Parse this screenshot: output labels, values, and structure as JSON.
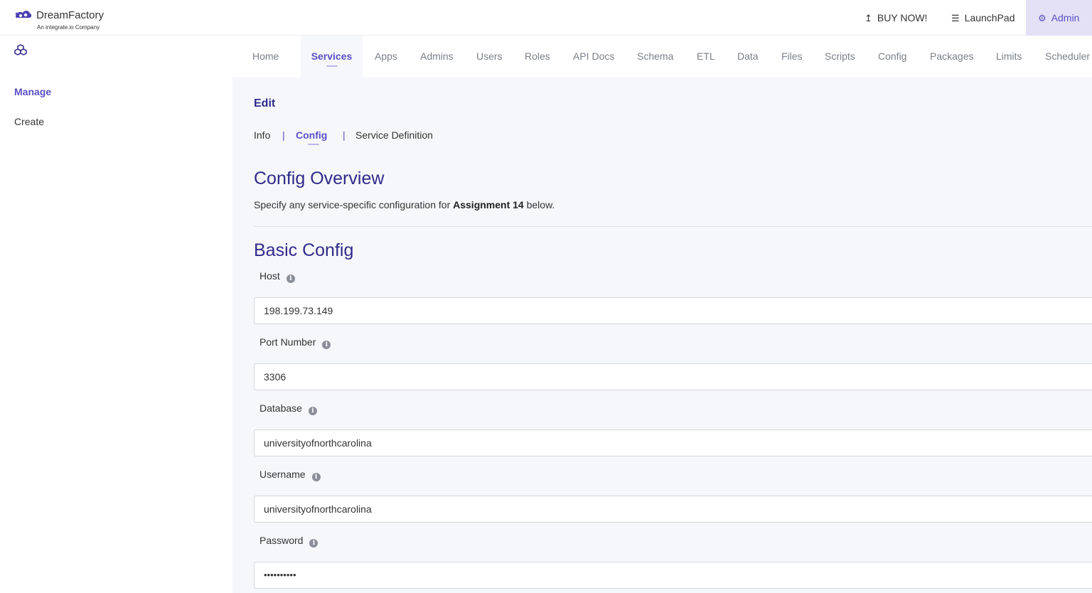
{
  "brand": {
    "name": "DreamFactory",
    "tagline": "An integrate.io Company",
    "colors": {
      "accent": "#5a4fc4",
      "heading": "#2f2a8a",
      "admin_bg": "#e4e1f6",
      "content_bg": "#f6f7fa"
    }
  },
  "header": {
    "buy_now": {
      "label": "BUY NOW!",
      "icon": "upload-arrow-icon"
    },
    "launchpad": {
      "label": "LaunchPad",
      "icon": "hamburger-menu-icon"
    },
    "admin": {
      "label": "Admin",
      "icon": "gear-icon"
    }
  },
  "sidebar": {
    "icon": "services-cubes-icon",
    "items": [
      {
        "label": "Manage",
        "active": true
      },
      {
        "label": "Create",
        "active": false
      }
    ]
  },
  "nav": {
    "tabs": [
      {
        "label": "Home"
      },
      {
        "label": "Services",
        "active": true
      },
      {
        "label": "Apps"
      },
      {
        "label": "Admins"
      },
      {
        "label": "Users"
      },
      {
        "label": "Roles"
      },
      {
        "label": "API Docs"
      },
      {
        "label": "Schema"
      },
      {
        "label": "ETL"
      },
      {
        "label": "Data"
      },
      {
        "label": "Files"
      },
      {
        "label": "Scripts"
      },
      {
        "label": "Config"
      },
      {
        "label": "Packages"
      },
      {
        "label": "Limits"
      },
      {
        "label": "Scheduler"
      }
    ]
  },
  "edit": {
    "title": "Edit",
    "subtabs": [
      {
        "label": "Info"
      },
      {
        "label": "Config",
        "active": true
      },
      {
        "label": "Service Definition"
      }
    ],
    "separator": "|"
  },
  "overview": {
    "heading": "Config Overview",
    "desc_prefix": "Specify any service-specific configuration for ",
    "service_name": "Assignment 14",
    "desc_suffix": " below."
  },
  "basic_config": {
    "heading": "Basic Config",
    "fields": [
      {
        "label": "Host",
        "value": "198.199.73.149"
      },
      {
        "label": "Port Number",
        "value": "3306"
      },
      {
        "label": "Database",
        "value": "universityofnorthcarolina"
      },
      {
        "label": "Username",
        "value": "universityofnorthcarolina"
      },
      {
        "label": "Password",
        "value": "••••••••••"
      }
    ]
  }
}
